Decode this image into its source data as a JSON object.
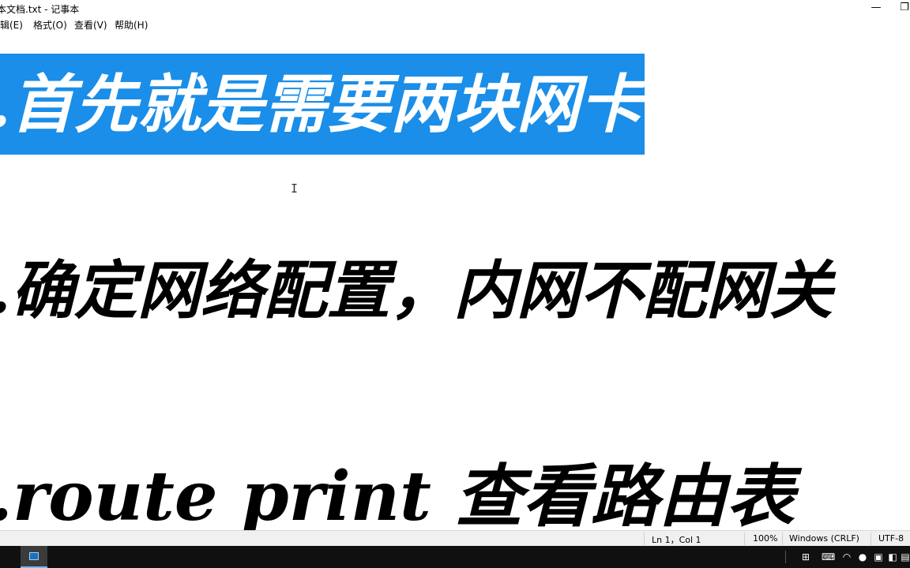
{
  "window": {
    "title": "本文档.txt - 记事本",
    "minimize_glyph": "—",
    "maximize_glyph": "❐"
  },
  "menu": {
    "edit": "编辑(E)",
    "format": "格式(O)",
    "view": "查看(V)",
    "help": "帮助(H)"
  },
  "editor": {
    "lines": [
      ".首先就是需要两块网卡",
      ".确定网络配置，内网不配网关",
      ".route print 查看路由表"
    ],
    "selection_color": "#1a8ee8"
  },
  "status": {
    "position": "Ln 1，Col 1",
    "zoom": "100%",
    "line_ending": "Windows (CRLF)",
    "encoding": "UTF-8"
  },
  "taskbar": {
    "active_app": "notepad-icon",
    "tray_icons": [
      "input-method-icon",
      "wifi-icon",
      "volume-icon",
      "network-icon",
      "notification-icon",
      "keyboard-icon",
      "mic-icon"
    ]
  }
}
